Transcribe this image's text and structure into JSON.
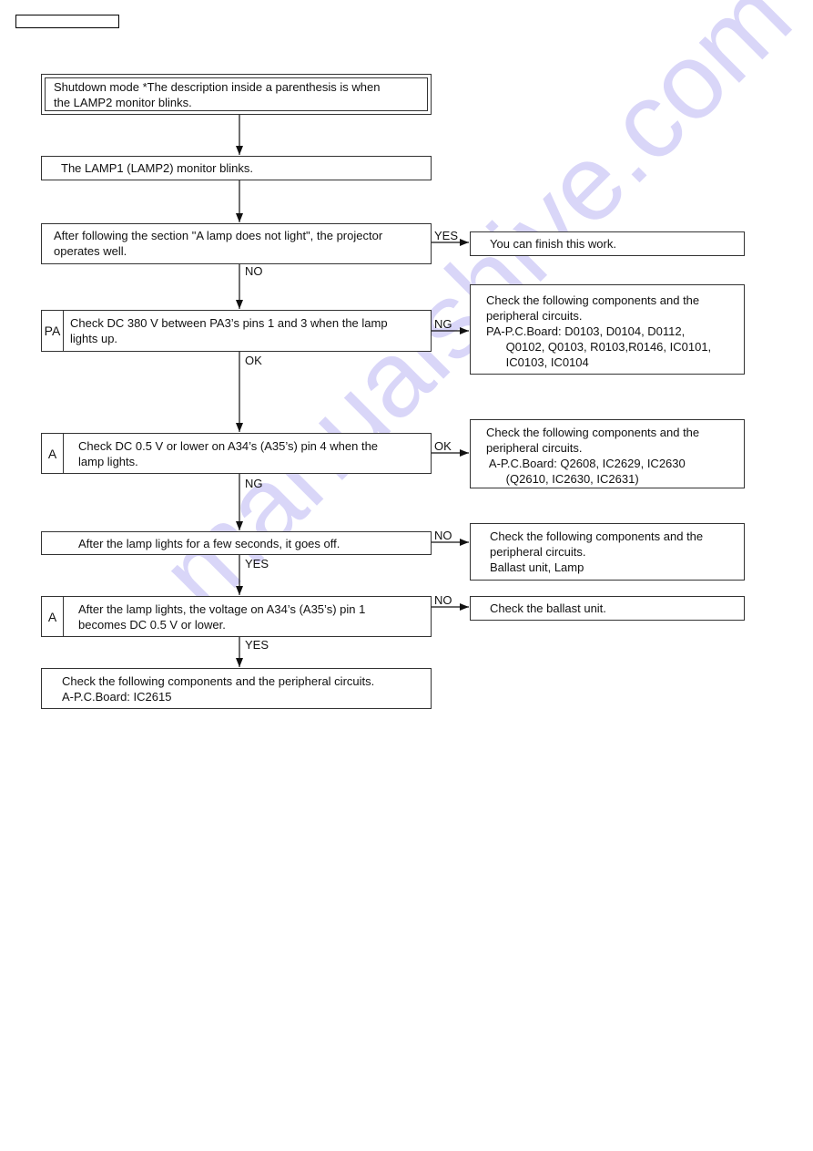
{
  "page": {
    "header_box_text": "",
    "watermark": "manualshive.com",
    "colors": {
      "line": "#111111",
      "watermark": "#d7d4f8",
      "background": "#ffffff"
    }
  },
  "flowchart": {
    "nodes": {
      "start": {
        "lines": [
          "Shutdown mode *The description inside a parenthesis is when",
          "the LAMP2 monitor blinks."
        ]
      },
      "blink": {
        "lines": [
          "The LAMP1 (LAMP2) monitor blinks."
        ]
      },
      "after_section": {
        "lines": [
          "After following the section \"A lamp does not light\", the projector",
          "operates well."
        ]
      },
      "finish": {
        "lines": [
          "You can finish this work."
        ]
      },
      "check_pa": {
        "tag": "PA",
        "lines": [
          "Check DC 380 V between PA3’s pins 1 and 3 when the lamp",
          "lights up."
        ]
      },
      "pa_components": {
        "lines": [
          "Check the following components and the",
          "peripheral circuits.",
          "PA-P.C.Board: D0103, D0104, D0112,",
          "      Q0102, Q0103, R0103,R0146, IC0101,",
          "      IC0103, IC0104"
        ]
      },
      "check_a_pin4": {
        "tag": "A",
        "lines": [
          "Check DC 0.5 V or lower on A34’s (A35’s) pin 4 when the",
          "lamp lights."
        ]
      },
      "a_components": {
        "lines": [
          "Check the following components and the",
          "peripheral circuits.",
          " A-P.C.Board: Q2608, IC2629, IC2630",
          "      (Q2610, IC2630, IC2631)"
        ]
      },
      "goes_off": {
        "lines": [
          "After the lamp lights for a few seconds, it goes off."
        ]
      },
      "ballast_lamp": {
        "lines": [
          "Check the following components and the",
          "peripheral circuits.",
          "Ballast unit, Lamp"
        ]
      },
      "check_a_pin1": {
        "tag": "A",
        "lines": [
          "After the lamp lights, the voltage on A34’s (A35’s) pin 1",
          "becomes DC 0.5 V or lower."
        ]
      },
      "ballast_only": {
        "lines": [
          "Check the ballast unit."
        ]
      },
      "final": {
        "lines": [
          "Check the following components and the peripheral circuits.",
          "A-P.C.Board: IC2615"
        ]
      }
    },
    "edges": [
      {
        "from": "start",
        "to": "blink",
        "label": ""
      },
      {
        "from": "blink",
        "to": "after_section",
        "label": ""
      },
      {
        "from": "after_section",
        "to": "finish",
        "label": "YES"
      },
      {
        "from": "after_section",
        "to": "check_pa",
        "label": "NO"
      },
      {
        "from": "check_pa",
        "to": "pa_components",
        "label": "NG"
      },
      {
        "from": "check_pa",
        "to": "check_a_pin4",
        "label": "OK"
      },
      {
        "from": "check_a_pin4",
        "to": "a_components",
        "label": "OK"
      },
      {
        "from": "check_a_pin4",
        "to": "goes_off",
        "label": "NG"
      },
      {
        "from": "goes_off",
        "to": "ballast_lamp",
        "label": "NO"
      },
      {
        "from": "goes_off",
        "to": "check_a_pin1",
        "label": "YES"
      },
      {
        "from": "check_a_pin1",
        "to": "ballast_only",
        "label": "NO"
      },
      {
        "from": "check_a_pin1",
        "to": "final",
        "label": "YES"
      }
    ]
  }
}
